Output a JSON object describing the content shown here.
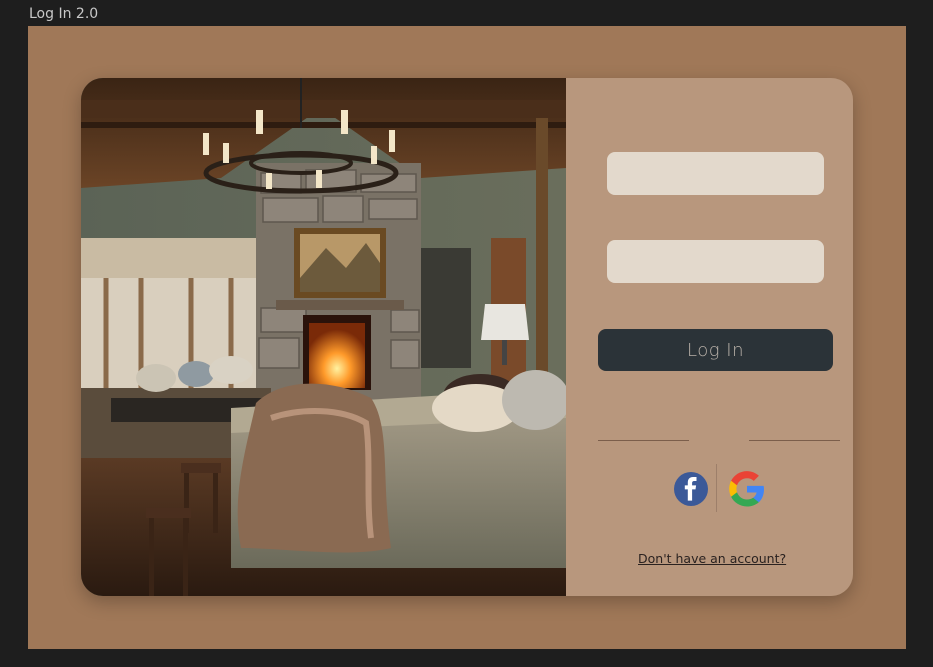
{
  "frame": {
    "title": "Log In 2.0"
  },
  "photo": {
    "description_icon": "bedroom-photo"
  },
  "form": {
    "username": {
      "value": "",
      "placeholder": ""
    },
    "password": {
      "value": "",
      "placeholder": ""
    },
    "login_label": "Log In",
    "social": [
      {
        "icon": "facebook-icon"
      },
      {
        "icon": "google-icon"
      }
    ],
    "signup_link": "Don't have an account?"
  },
  "colors": {
    "background": "#a07858",
    "panel": "#b8977d",
    "input": "#e3d9cc",
    "button": "#2b3338",
    "facebook": "#3b5998"
  }
}
